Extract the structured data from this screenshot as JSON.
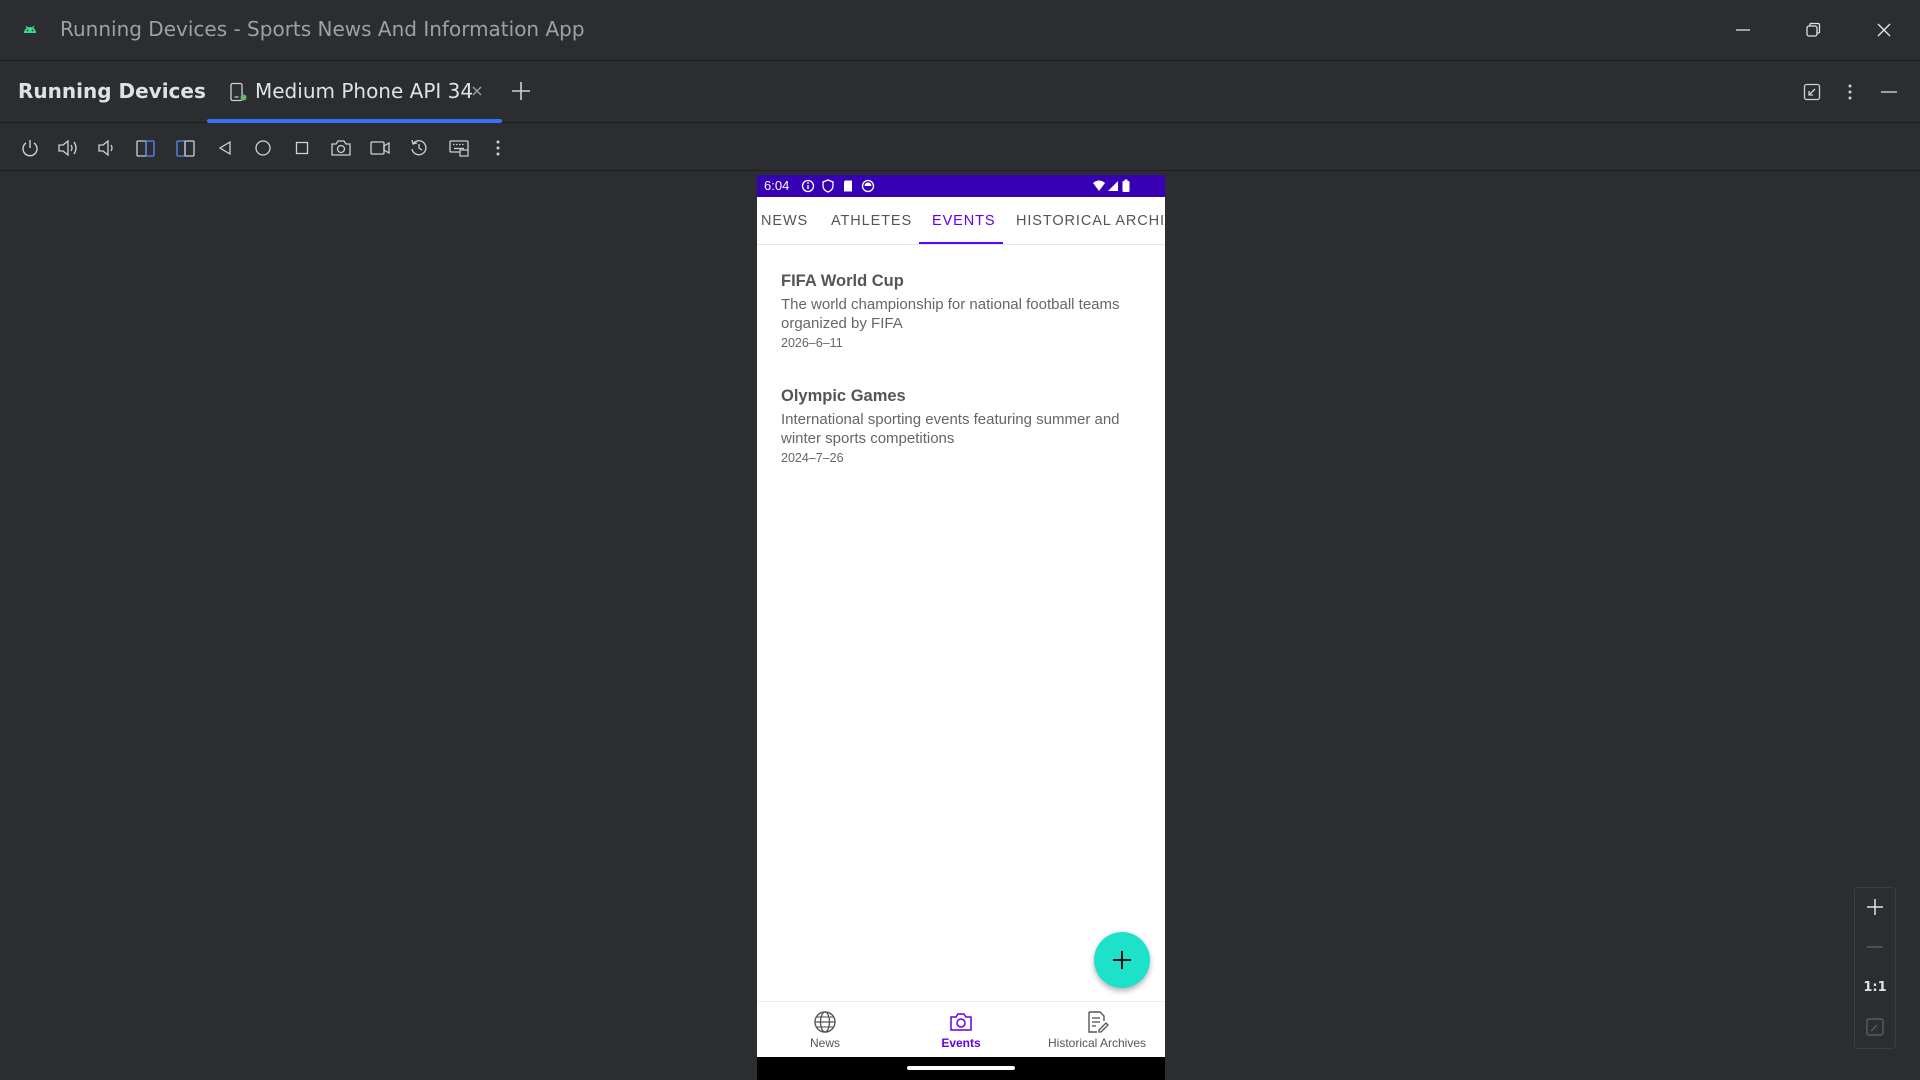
{
  "window": {
    "title": "Running Devices - Sports News And Information App",
    "icons": [
      "android-icon",
      "minimize-icon",
      "restore-icon",
      "close-icon"
    ]
  },
  "tool_window": {
    "title": "Running Devices",
    "device_tab": {
      "label": "Medium Phone API 34",
      "icon": "device-icon",
      "accent": "#3574f0"
    }
  },
  "toolbar": {
    "icons": [
      "power-icon",
      "volume-up-icon",
      "volume-down-icon",
      "rotate-left-icon",
      "rotate-right-icon",
      "back-icon",
      "home-icon",
      "overview-icon",
      "screenshot-icon",
      "screen-record-icon",
      "reset-icon",
      "keyboard-icon",
      "more-options-icon"
    ]
  },
  "phone": {
    "status_bar": {
      "time": "6:04",
      "color": "#3700b3"
    },
    "tabs": [
      {
        "label": "NEWS",
        "active": false
      },
      {
        "label": "ATHLETES",
        "active": false
      },
      {
        "label": "EVENTS",
        "active": true
      },
      {
        "label": "HISTORICAL ARCHIV",
        "active": false
      }
    ],
    "events": [
      {
        "title": "FIFA World Cup",
        "description": "The world championship for national football teams organized by FIFA",
        "date": "2026–6–11"
      },
      {
        "title": "Olympic Games",
        "description": "International sporting events featuring summer and winter sports competitions",
        "date": "2024–7–26"
      }
    ],
    "fab": {
      "icon": "add-icon",
      "color": "#1de2c9"
    },
    "bottom_nav": [
      {
        "label": "News",
        "icon": "globe-icon",
        "active": false
      },
      {
        "label": "Events",
        "icon": "camera-icon",
        "active": true
      },
      {
        "label": "Historical Archives",
        "icon": "document-edit-icon",
        "active": false
      }
    ],
    "accent": "#6200ee"
  },
  "zoom_controls": {
    "actual_size_label": "1:1"
  }
}
